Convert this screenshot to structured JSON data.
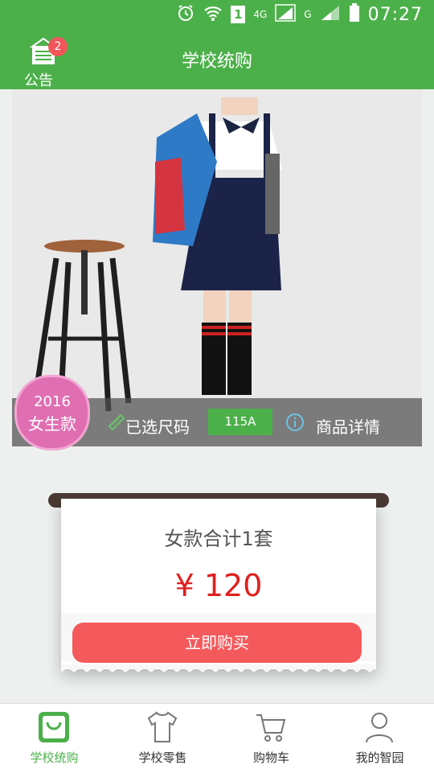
{
  "status_bar": {
    "time": "07:27",
    "network": "4G",
    "network2": "G",
    "sim": "1"
  },
  "header": {
    "title": "学校统购",
    "notice_label": "公告",
    "notice_count": "2"
  },
  "product": {
    "year": "2016",
    "category": "女生款",
    "size_label": "已选尺码",
    "size_value": "115A",
    "detail_label": "商品详情"
  },
  "summary": {
    "text": "女款合计1套",
    "price": "¥ 120"
  },
  "buy_button": {
    "label": "立即购买"
  },
  "tabs": [
    {
      "label": "学校统购",
      "icon": "bag-icon",
      "active": true
    },
    {
      "label": "学校零售",
      "icon": "shirt-icon",
      "active": false
    },
    {
      "label": "购物车",
      "icon": "cart-icon",
      "active": false
    },
    {
      "label": "我的智园",
      "icon": "person-icon",
      "active": false
    }
  ],
  "colors": {
    "brand": "#4cb04a",
    "price": "#e0201e",
    "buy": "#f45a5c",
    "badge": "#f0565a"
  }
}
